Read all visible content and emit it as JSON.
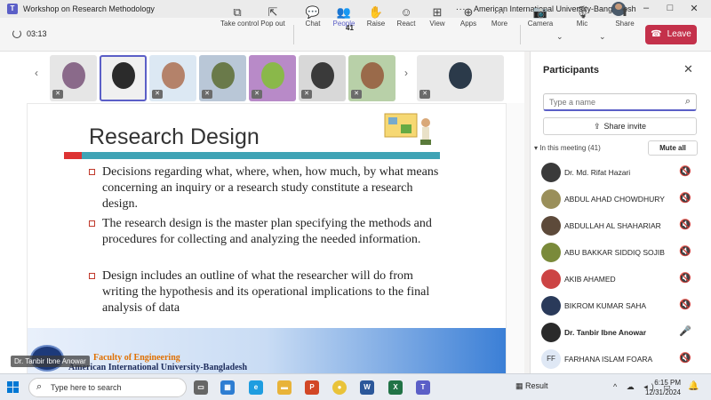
{
  "window": {
    "title": "Workshop on Research Methodology",
    "organization": "American International University-Bangladesh",
    "more": "...",
    "minimize": "–",
    "maximize": "□",
    "close": "✕"
  },
  "toolbar": {
    "timer": "03:13",
    "people_count": "41",
    "items": [
      {
        "label": "Take control",
        "icon": "take-control-icon",
        "glyph": "⧉"
      },
      {
        "label": "Pop out",
        "icon": "pop-out-icon",
        "glyph": "⇱"
      },
      {
        "label": "Chat",
        "icon": "chat-icon",
        "glyph": "💬"
      },
      {
        "label": "People",
        "icon": "people-icon",
        "glyph": "👥"
      },
      {
        "label": "Raise",
        "icon": "raise-hand-icon",
        "glyph": "✋"
      },
      {
        "label": "React",
        "icon": "react-icon",
        "glyph": "☺"
      },
      {
        "label": "View",
        "icon": "view-icon",
        "glyph": "⊞"
      },
      {
        "label": "Apps",
        "icon": "apps-icon",
        "glyph": "⊕"
      },
      {
        "label": "More",
        "icon": "more-icon",
        "glyph": "···"
      },
      {
        "label": "Camera",
        "icon": "camera-icon",
        "glyph": "📷"
      },
      {
        "label": "Mic",
        "icon": "mic-icon",
        "glyph": "🎙"
      },
      {
        "label": "Share",
        "icon": "share-icon",
        "glyph": "⬆"
      }
    ],
    "leave_label": "Leave"
  },
  "slide": {
    "title": "Research Design",
    "bullets": [
      "Decisions regarding what, where, when, how much, by what means concerning an inquiry or a research study constitute a research design.",
      "The research design is the master plan specifying the methods and procedures for collecting and analyzing the needed information.",
      "Design includes an outline of what the researcher will do from writing the hypothesis and its operational implications to the final analysis of data"
    ],
    "footer_line1": "Faculty of Engineering",
    "footer_line2": "American International University-Bangladesh"
  },
  "presenter_label": "Dr. Tanbir Ibne Anowar",
  "participants": {
    "title": "Participants",
    "search_placeholder": "Type a name",
    "share_invite": "Share invite",
    "in_meeting": "In this meeting (41)",
    "mute_all": "Mute all",
    "list": [
      {
        "name": "Dr. Md. Rifat Hazari",
        "avatar_color": "#3a3a3a",
        "initials": "",
        "muted": true
      },
      {
        "name": "ABDUL AHAD CHOWDHURY",
        "avatar_color": "#9a8f5a",
        "initials": "",
        "muted": true
      },
      {
        "name": "ABDULLAH AL SHAHARIAR",
        "avatar_color": "#5d4a3a",
        "initials": "",
        "muted": true
      },
      {
        "name": "ABU BAKKAR SIDDIQ SOJIB",
        "avatar_color": "#7a8a3a",
        "initials": "",
        "muted": true
      },
      {
        "name": "AKIB AHAMED",
        "avatar_color": "#c44",
        "initials": "",
        "muted": true
      },
      {
        "name": "BIKROM KUMAR SAHA",
        "avatar_color": "#2a3a5a",
        "initials": "",
        "muted": true
      },
      {
        "name": "Dr. Tanbir Ibne Anowar",
        "avatar_color": "#2a2a2a",
        "initials": "",
        "muted": false
      },
      {
        "name": "FARHANA ISLAM FOARA",
        "avatar_color": "#dfe8f5",
        "initials": "FF",
        "muted": true
      }
    ]
  },
  "taskbar": {
    "search_placeholder": "Type here to search",
    "result_label": "Result",
    "time": "6:15 PM",
    "date": "12/31/2024",
    "tray": "^ ☁ ◂) ▭"
  }
}
